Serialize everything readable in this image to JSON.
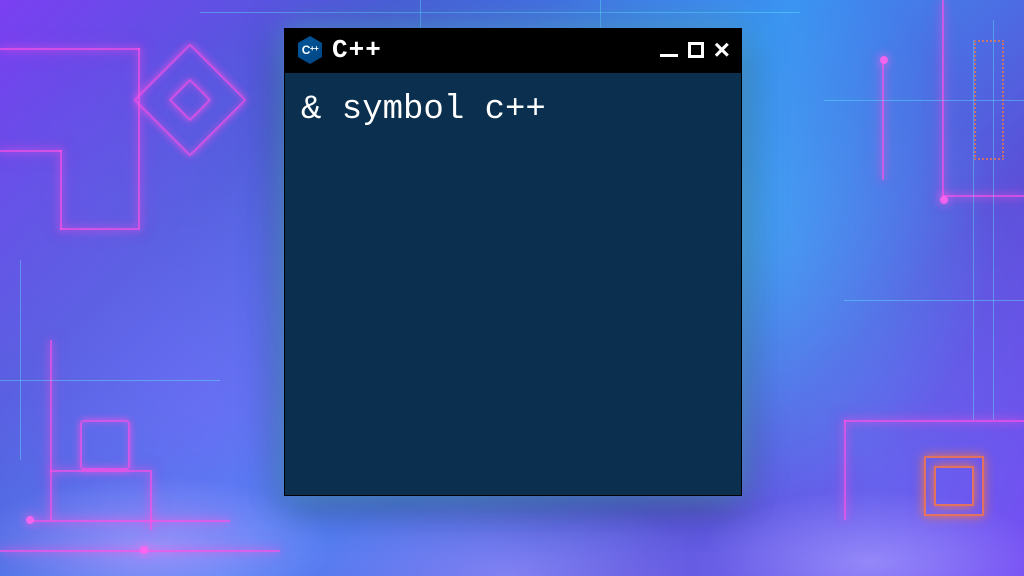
{
  "window": {
    "title": "C++",
    "icon_name": "cpp-icon",
    "icon_letter": "C⁺⁺"
  },
  "terminal": {
    "content": "& symbol c++"
  },
  "colors": {
    "terminal_bg": "#0a2f4f",
    "titlebar_bg": "#000000",
    "text": "#ffffff"
  }
}
